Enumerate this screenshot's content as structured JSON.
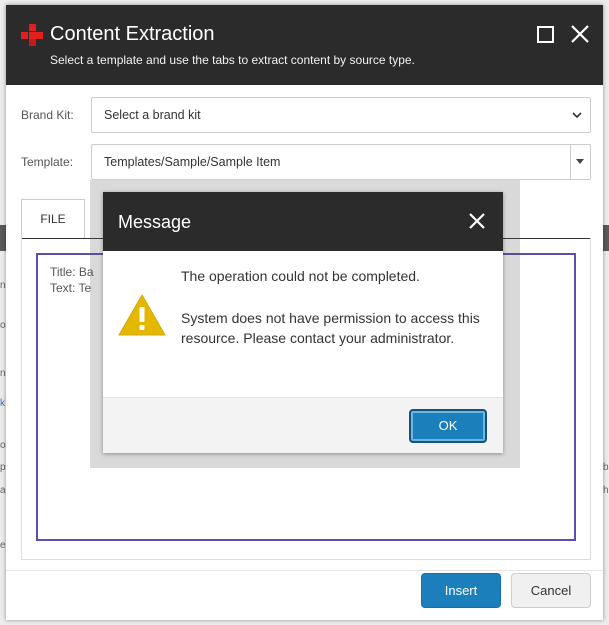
{
  "dialog": {
    "title": "Content Extraction",
    "subtitle": "Select a template and use the tabs to extract content by source type."
  },
  "form": {
    "brand_kit_label": "Brand Kit:",
    "brand_kit_value": "Select a brand kit",
    "template_label": "Template:",
    "template_value": "Templates/Sample/Sample Item"
  },
  "tabs": [
    {
      "label": "FILE"
    }
  ],
  "content": {
    "title_line": "Title: Ba",
    "text_line": "Text: Te"
  },
  "footer": {
    "insert_label": "Insert",
    "cancel_label": "Cancel"
  },
  "message": {
    "title": "Message",
    "line1": "The operation could not be completed.",
    "line2": "System does not have permission to access this resource. Please contact your administrator.",
    "ok_label": "OK",
    "icon": "warning-icon"
  },
  "colors": {
    "header_bg": "#2b2b2b",
    "primary": "#1a7fba",
    "content_border": "#5a4fb0",
    "warning": "#e5b800",
    "brand_red": "#e02020"
  },
  "background_fragments": [
    "ne",
    "oi",
    "ne",
    "k",
    "ol",
    "p",
    "a",
    "ea",
    "b",
    "h"
  ]
}
